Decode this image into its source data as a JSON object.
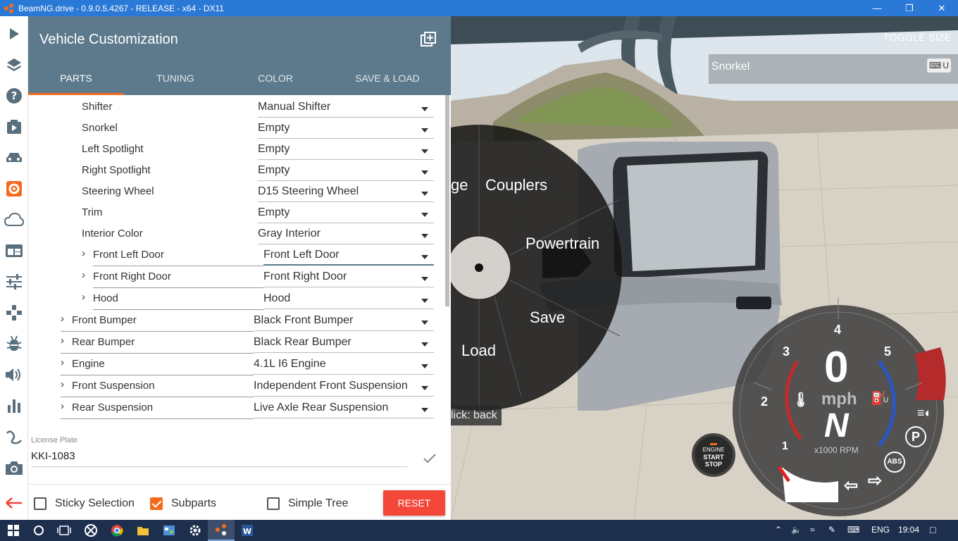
{
  "window": {
    "title": "BeamNG.drive - 0.9.0.5.4267 - RELEASE - x64 - DX11",
    "minimize_icon": "minimize-icon",
    "restore_icon": "restore-icon",
    "close_icon": "close-icon"
  },
  "sidebar_icons": [
    "play-icon",
    "layers-icon",
    "help-icon",
    "scenario-icon",
    "vehicle-icon",
    "gear-icon",
    "cloud-icon",
    "ui-apps-icon",
    "sliders-icon",
    "gamepad-icon",
    "bug-icon",
    "volume-icon",
    "stats-icon",
    "route-icon",
    "camera-icon",
    "back-arrow-icon"
  ],
  "panel": {
    "title": "Vehicle Customization",
    "add_icon": "add-window-icon",
    "tabs": [
      {
        "label": "PARTS",
        "active": true
      },
      {
        "label": "TUNING",
        "active": false
      },
      {
        "label": "COLOR",
        "active": false
      },
      {
        "label": "SAVE & LOAD",
        "active": false
      }
    ],
    "parts": [
      {
        "label": "Shifter",
        "value": "Manual Shifter"
      },
      {
        "label": "Snorkel",
        "value": "Empty"
      },
      {
        "label": "Left Spotlight",
        "value": "Empty"
      },
      {
        "label": "Right Spotlight",
        "value": "Empty"
      },
      {
        "label": "Steering Wheel",
        "value": "D15 Steering Wheel"
      },
      {
        "label": "Trim",
        "value": "Empty"
      },
      {
        "label": "Interior Color",
        "value": "Gray Interior"
      },
      {
        "label": "Front Left Door",
        "value": "Front Left Door"
      },
      {
        "label": "Front Right Door",
        "value": "Front Right Door"
      },
      {
        "label": "Hood",
        "value": "Hood"
      },
      {
        "label": "Front Bumper",
        "value": "Black Front Bumper"
      },
      {
        "label": "Rear Bumper",
        "value": "Black Rear Bumper"
      },
      {
        "label": "Engine",
        "value": "4.1L I6 Engine"
      },
      {
        "label": "Front Suspension",
        "value": "Independent Front Suspension"
      },
      {
        "label": "Rear Suspension",
        "value": "Live Axle Rear Suspension"
      }
    ],
    "license_plate": {
      "label": "License Plate",
      "value": "KKI-1083"
    },
    "options": {
      "sticky_selection": {
        "label": "Sticky Selection",
        "checked": false
      },
      "subparts": {
        "label": "Subparts",
        "checked": true
      },
      "simple_tree": {
        "label": "Simple Tree",
        "checked": false
      }
    },
    "reset_label": "RESET"
  },
  "scene": {
    "toggle_size": "TOGGLE SIZE",
    "part_name": "Snorkel",
    "kbd_key": "U",
    "radial_menu": {
      "items": [
        "ge",
        "Couplers",
        "Powertrain",
        "Save",
        "Load"
      ],
      "hint": "lick: back"
    },
    "engine_button": {
      "line1": "ENGINE",
      "line2": "START",
      "line3": "STOP"
    },
    "gauge": {
      "speed": "0",
      "unit": "mph",
      "gear": "N",
      "rpm_label": "x1000 RPM",
      "ticks": [
        "1",
        "2",
        "3",
        "4",
        "5"
      ],
      "parking": "P",
      "abs": "ABS",
      "fuel_unit": "U"
    }
  },
  "taskbar": {
    "language": "ENG",
    "time": "19:04",
    "apps": [
      "start-icon",
      "search-icon",
      "task-view-icon",
      "xbox-icon",
      "chrome-icon",
      "explorer-icon",
      "control-panel-icon",
      "settings-icon",
      "beamng-icon",
      "word-icon"
    ]
  },
  "colors": {
    "accent": "#f46b1f",
    "header": "#5d7a8c",
    "reset": "#f4473a",
    "titlebar": "#2b79d6",
    "taskbar": "#1e2f4e"
  }
}
